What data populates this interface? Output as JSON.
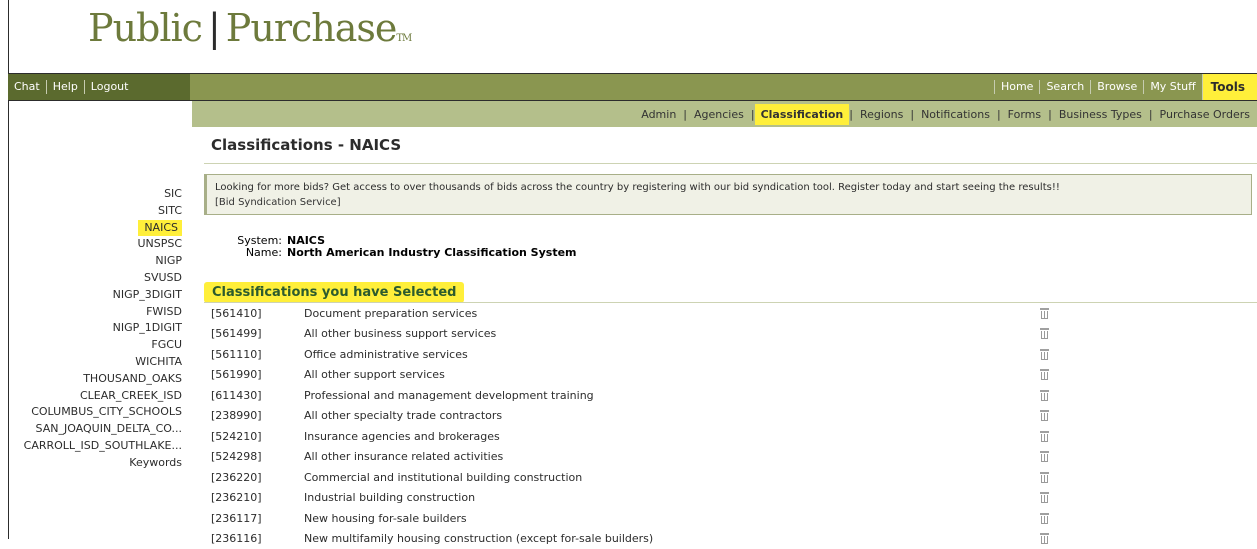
{
  "logo": {
    "part1": "Public",
    "separator": "|",
    "part2": "Purchase",
    "tm": "TM"
  },
  "left_nav": [
    "Chat",
    "Help",
    "Logout"
  ],
  "top_nav": [
    {
      "label": "Home",
      "active": false
    },
    {
      "label": "Search",
      "active": false
    },
    {
      "label": "Browse",
      "active": false
    },
    {
      "label": "My Stuff",
      "active": false
    },
    {
      "label": "Tools",
      "active": true
    }
  ],
  "sub_nav": [
    {
      "label": "Admin",
      "active": false
    },
    {
      "label": "Agencies",
      "active": false
    },
    {
      "label": "Classification",
      "active": true
    },
    {
      "label": "Regions",
      "active": false
    },
    {
      "label": "Notifications",
      "active": false
    },
    {
      "label": "Forms",
      "active": false
    },
    {
      "label": "Business Types",
      "active": false
    },
    {
      "label": "Purchase Orders",
      "active": false
    }
  ],
  "page_title": "Classifications - NAICS",
  "notice": {
    "text": "Looking for more bids? Get access to over thousands of bids across the country by registering with our bid syndication tool. Register today and start seeing the results!!",
    "link": "[Bid Syndication Service]"
  },
  "system": {
    "system_label": "System:",
    "system_value": "NAICS",
    "name_label": "Name:",
    "name_value": "North American Industry Classification System"
  },
  "selected_title": "Classifications you have Selected",
  "classifications": [
    {
      "code": "[561410]",
      "desc": "Document preparation services"
    },
    {
      "code": "[561499]",
      "desc": "All other business support services"
    },
    {
      "code": "[561110]",
      "desc": "Office administrative services"
    },
    {
      "code": "[561990]",
      "desc": "All other support services"
    },
    {
      "code": "[611430]",
      "desc": "Professional and management development training"
    },
    {
      "code": "[238990]",
      "desc": "All other specialty trade contractors"
    },
    {
      "code": "[524210]",
      "desc": "Insurance agencies and brokerages"
    },
    {
      "code": "[524298]",
      "desc": "All other insurance related activities"
    },
    {
      "code": "[236220]",
      "desc": "Commercial and institutional building construction"
    },
    {
      "code": "[236210]",
      "desc": "Industrial building construction"
    },
    {
      "code": "[236117]",
      "desc": "New housing for-sale builders"
    },
    {
      "code": "[236116]",
      "desc": "New multifamily housing construction (except for-sale builders)"
    }
  ],
  "sidebar": [
    {
      "label": "SIC",
      "active": false
    },
    {
      "label": "SITC",
      "active": false
    },
    {
      "label": "NAICS",
      "active": true
    },
    {
      "label": "UNSPSC",
      "active": false
    },
    {
      "label": "NIGP",
      "active": false
    },
    {
      "label": "SVUSD",
      "active": false
    },
    {
      "label": "NIGP_3DIGIT",
      "active": false
    },
    {
      "label": "FWISD",
      "active": false
    },
    {
      "label": "NIGP_1DIGIT",
      "active": false
    },
    {
      "label": "FGCU",
      "active": false
    },
    {
      "label": "WICHITA",
      "active": false
    },
    {
      "label": "THOUSAND_OAKS",
      "active": false
    },
    {
      "label": "CLEAR_CREEK_ISD",
      "active": false
    },
    {
      "label": "COLUMBUS_CITY_SCHOOLS",
      "active": false
    },
    {
      "label": "SAN_JOAQUIN_DELTA_CO...",
      "active": false
    },
    {
      "label": "CARROLL_ISD_SOUTHLAKE...",
      "active": false
    },
    {
      "label": "Keywords",
      "active": false
    }
  ],
  "colors": {
    "olive_dark": "#5b6a2e",
    "olive": "#8a9650",
    "olive_light": "#b4bf8b",
    "highlight": "#ffef3a"
  }
}
